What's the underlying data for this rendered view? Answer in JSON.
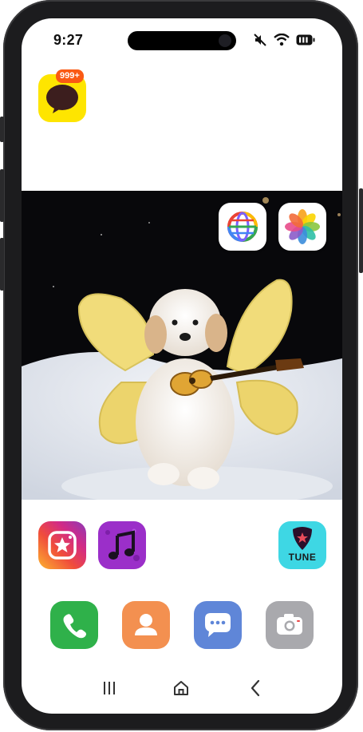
{
  "status_bar": {
    "time": "9:27",
    "icons": [
      "mute-icon",
      "wifi-icon",
      "battery-icon"
    ]
  },
  "apps": {
    "kakaotalk": {
      "icon": "chat-bubble-icon",
      "badge": "999+"
    },
    "browser": {
      "icon": "globe-icon"
    },
    "photos": {
      "icon": "pinwheel-icon"
    },
    "instagram": {
      "icon": "star-camera-icon"
    },
    "music": {
      "icon": "music-note-icon"
    },
    "tune": {
      "icon": "guitar-pick-icon",
      "label": "TUNE"
    }
  },
  "dock": {
    "items": [
      {
        "name": "phone",
        "icon": "phone-icon"
      },
      {
        "name": "contacts",
        "icon": "person-icon"
      },
      {
        "name": "messages",
        "icon": "message-bubble-icon"
      },
      {
        "name": "camera",
        "icon": "camera-icon"
      }
    ]
  },
  "nav_bar": {
    "items": [
      "recents-icon",
      "home-icon",
      "back-icon"
    ]
  },
  "wallpaper": {
    "subject": "puppy-with-wings-and-ukulele"
  },
  "colors": {
    "kakao": "#fee500",
    "badge": "#fa5a14",
    "phone": "#2fb14a",
    "contacts": "#f39050",
    "messages": "#5f86d8",
    "camera": "#a9a9ad",
    "tune": "#3ed7e4",
    "music": "#9b2fc9"
  }
}
